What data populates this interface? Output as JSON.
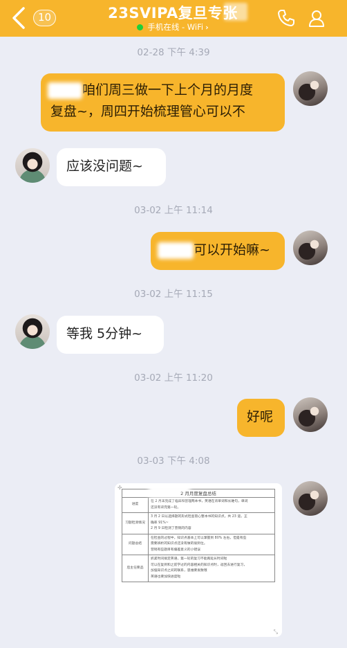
{
  "header": {
    "back_badge": "10",
    "title": "23SVIPA复旦专张",
    "status": "手机在线 - WiFi",
    "status_color": "#1fcf3b",
    "accent": "#f7b52c",
    "icons": [
      "back-chevron-icon",
      "phone-icon",
      "profile-icon"
    ]
  },
  "messages": [
    {
      "type": "timestamp",
      "text": "02-28 下午 4:39"
    },
    {
      "type": "outgoing",
      "lines": [
        "咱们周三做一下上个月的月度",
        "复盘~，周四开始梳理管心可以不"
      ]
    },
    {
      "type": "incoming",
      "text": "应该没问题~"
    },
    {
      "type": "timestamp",
      "text": "03-02 上午 11:14"
    },
    {
      "type": "outgoing",
      "text": "可以开始嘛~"
    },
    {
      "type": "timestamp",
      "text": "03-02 上午 11:15"
    },
    {
      "type": "incoming",
      "text": "等我 5分钟~"
    },
    {
      "type": "timestamp",
      "text": "03-02 上午 11:20"
    },
    {
      "type": "outgoing",
      "text": "好呢"
    },
    {
      "type": "timestamp",
      "text": "03-03 下午 4:08"
    }
  ],
  "document": {
    "title": "2 月月度复盘总结",
    "rows": [
      {
        "key": "进度",
        "lines": [
          "在 2 月末完成了临床和营理两本书，英语在背单词和长难句，单词",
          "还没有背完第一轮。"
        ]
      },
      {
        "key": "习题检测情况",
        "lines": [
          "3 月 2 日以选择题的形式检查管心整本书的知识点，共 23 道，正",
          "确率 91%~",
          "2 月 9 日检测了营销的内容"
        ]
      },
      {
        "key": "问题总结",
        "lines": [
          "在检查的过程中，知识点基本上可以掌握到 80% 左右，但是有些",
          "需要辨析的知识点还没有做的很到位。",
          "营销有些题目有偏差意义的小错误"
        ]
      },
      {
        "key": "后主任要品",
        "lines": [
          "抓紧时间搞定英语，第一轮的复习不能再延长时间啦",
          "可以在复到和之前学过的内容相关的知识点时，返回去进行复习，",
          "加强知识点之间的联系，思维要发散哦",
          "英语也要加快进度啦"
        ]
      }
    ]
  }
}
